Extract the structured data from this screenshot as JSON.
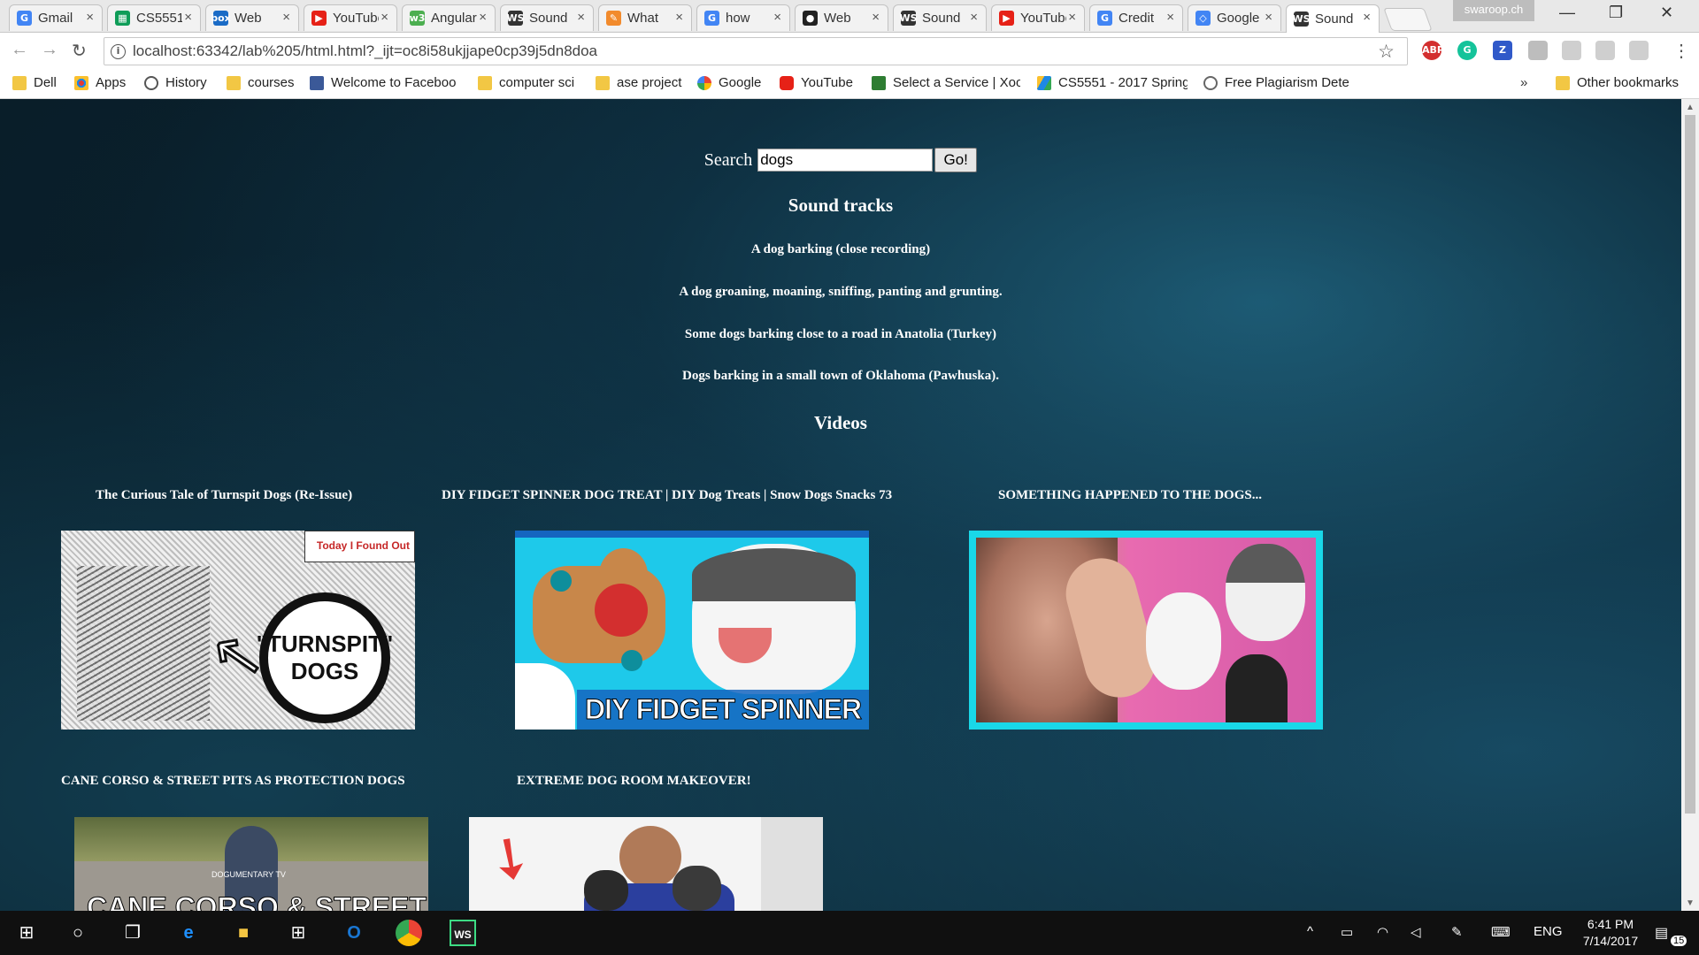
{
  "browser": {
    "tabs": [
      {
        "label": "Gmail",
        "favicon": "G",
        "color": "#4285f4"
      },
      {
        "label": "CS5551",
        "favicon": "▦",
        "color": "#0f9d58"
      },
      {
        "label": "Web",
        "favicon": "box",
        "color": "#1a6bc6"
      },
      {
        "label": "YouTube",
        "favicon": "▶",
        "color": "#e62117"
      },
      {
        "label": "Angular",
        "favicon": "w3",
        "color": "#4caf50"
      },
      {
        "label": "Sound",
        "favicon": "WS",
        "color": "#333333"
      },
      {
        "label": "What",
        "favicon": "✎",
        "color": "#f28b2d"
      },
      {
        "label": "how",
        "favicon": "G",
        "color": "#4285f4"
      },
      {
        "label": "Web",
        "favicon": "●",
        "color": "#222222"
      },
      {
        "label": "Sound",
        "favicon": "WS",
        "color": "#333333"
      },
      {
        "label": "YouTube",
        "favicon": "▶",
        "color": "#e62117"
      },
      {
        "label": "Credit",
        "favicon": "G",
        "color": "#4285f4"
      },
      {
        "label": "Google",
        "favicon": "◇",
        "color": "#4285f4"
      },
      {
        "label": "Sound",
        "favicon": "WS",
        "color": "#333333",
        "active": true
      }
    ],
    "profile_name": "swaroop.ch",
    "url": "localhost:63342/lab%205/html.html?_ijt=oc8i58ukjjape0cp39j5dn8doa",
    "extensions": [
      "ABP",
      "G",
      "Z"
    ],
    "bookmarks": [
      {
        "label": "Dell",
        "icon": "folder-icon"
      },
      {
        "label": "Apps",
        "icon": "apps-grid-icon"
      },
      {
        "label": "History",
        "icon": "history-icon"
      },
      {
        "label": "courses",
        "icon": "folder-icon"
      },
      {
        "label": "Welcome to Faceboo",
        "icon": "facebook-icon"
      },
      {
        "label": "computer sci",
        "icon": "folder-icon"
      },
      {
        "label": "ase project",
        "icon": "folder-icon"
      },
      {
        "label": "Google",
        "icon": "google-icon"
      },
      {
        "label": "YouTube",
        "icon": "youtube-icon"
      },
      {
        "label": "Select a Service | Xoo",
        "icon": "xoom-icon"
      },
      {
        "label": "CS5551 - 2017 Spring",
        "icon": "drive-icon"
      },
      {
        "label": "Free Plagiarism Dete",
        "icon": "search-icon"
      }
    ],
    "bookmarks_overflow": "»",
    "other_bookmarks": "Other bookmarks"
  },
  "page": {
    "search_label": "Search",
    "search_value": "dogs",
    "go_label": "Go!",
    "soundtracks_heading": "Sound tracks",
    "soundtracks": [
      "A dog barking (close recording)",
      "A dog groaning, moaning, sniffing, panting and grunting.",
      "Some dogs barking close to a road in Anatolia (Turkey)",
      "Dogs barking in a small town of Oklahoma (Pawhuska)."
    ],
    "videos_heading": "Videos",
    "videos": [
      {
        "title": "The Curious Tale of Turnspit Dogs (Re-Issue)",
        "thumb_text": "\"TURNSPIT\" DOGS",
        "badge": "Today I Found Out"
      },
      {
        "title": "DIY FIDGET SPINNER DOG TREAT | DIY Dog Treats | Snow Dogs Snacks 73",
        "thumb_text": "DIY FIDGET SPINNER"
      },
      {
        "title": "SOMETHING HAPPENED TO THE DOGS..."
      },
      {
        "title": "CANE CORSO & STREET PITS AS PROTECTION DOGS",
        "thumb_text": "CANE CORSO & STREET PITS",
        "badge": "DOGUMENTARY TV"
      },
      {
        "title": "EXTREME DOG ROOM MAKEOVER!"
      }
    ]
  },
  "taskbar": {
    "time": "6:41 PM",
    "date": "7/14/2017",
    "language": "ENG",
    "notifications": "15"
  }
}
